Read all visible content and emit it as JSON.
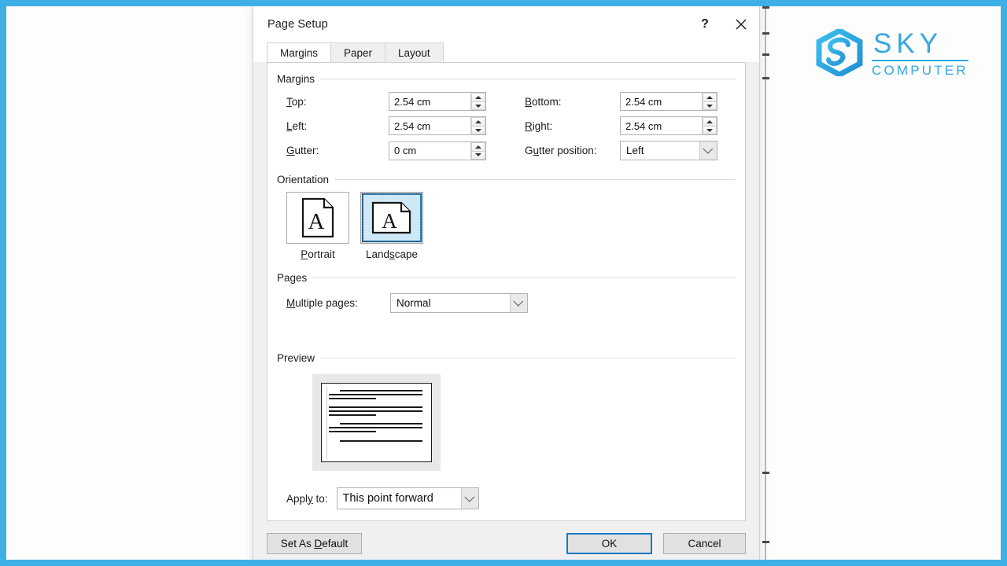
{
  "frame": {
    "accent_color": "#3fb0e5"
  },
  "logo": {
    "mark_name": "sky-hex-s-logo",
    "primary": "SKY",
    "secondary": "COMPUTER",
    "color": "#35a8e0"
  },
  "dialog": {
    "title": "Page Setup",
    "help_label": "?",
    "close_label": "✕",
    "tabs": [
      {
        "label": "Margins",
        "active": true
      },
      {
        "label": "Paper",
        "active": false
      },
      {
        "label": "Layout",
        "active": false
      }
    ],
    "groups": {
      "margins": {
        "label": "Margins",
        "fields": [
          {
            "label": "Top:",
            "value": "2.54 cm",
            "type": "spinner"
          },
          {
            "label": "Bottom:",
            "value": "2.54 cm",
            "type": "spinner"
          },
          {
            "label": "Left:",
            "value": "2.54 cm",
            "type": "spinner"
          },
          {
            "label": "Right:",
            "value": "2.54 cm",
            "type": "spinner"
          },
          {
            "label": "Gutter:",
            "value": "0 cm",
            "type": "spinner"
          },
          {
            "label": "Gutter position:",
            "value": "Left",
            "type": "combo"
          }
        ]
      },
      "orientation": {
        "label": "Orientation",
        "options": [
          {
            "label": "Portrait",
            "selected": false,
            "shape": "tall"
          },
          {
            "label": "Landscape",
            "selected": true,
            "shape": "wide"
          }
        ]
      },
      "pages": {
        "label": "Pages",
        "multiple_pages_label": "Multiple pages:",
        "multiple_pages_value": "Normal"
      },
      "preview": {
        "label": "Preview",
        "page_orientation": "landscape",
        "line_groups": [
          [
            100,
            100,
            55
          ],
          [
            100,
            100,
            45
          ],
          [
            100,
            100,
            45
          ],
          [
            100
          ]
        ]
      }
    },
    "apply_to": {
      "label": "Apply to:",
      "value": "This point forward"
    },
    "buttons": {
      "set_as_default": "Set As Default",
      "ok": "OK",
      "cancel": "Cancel"
    }
  }
}
